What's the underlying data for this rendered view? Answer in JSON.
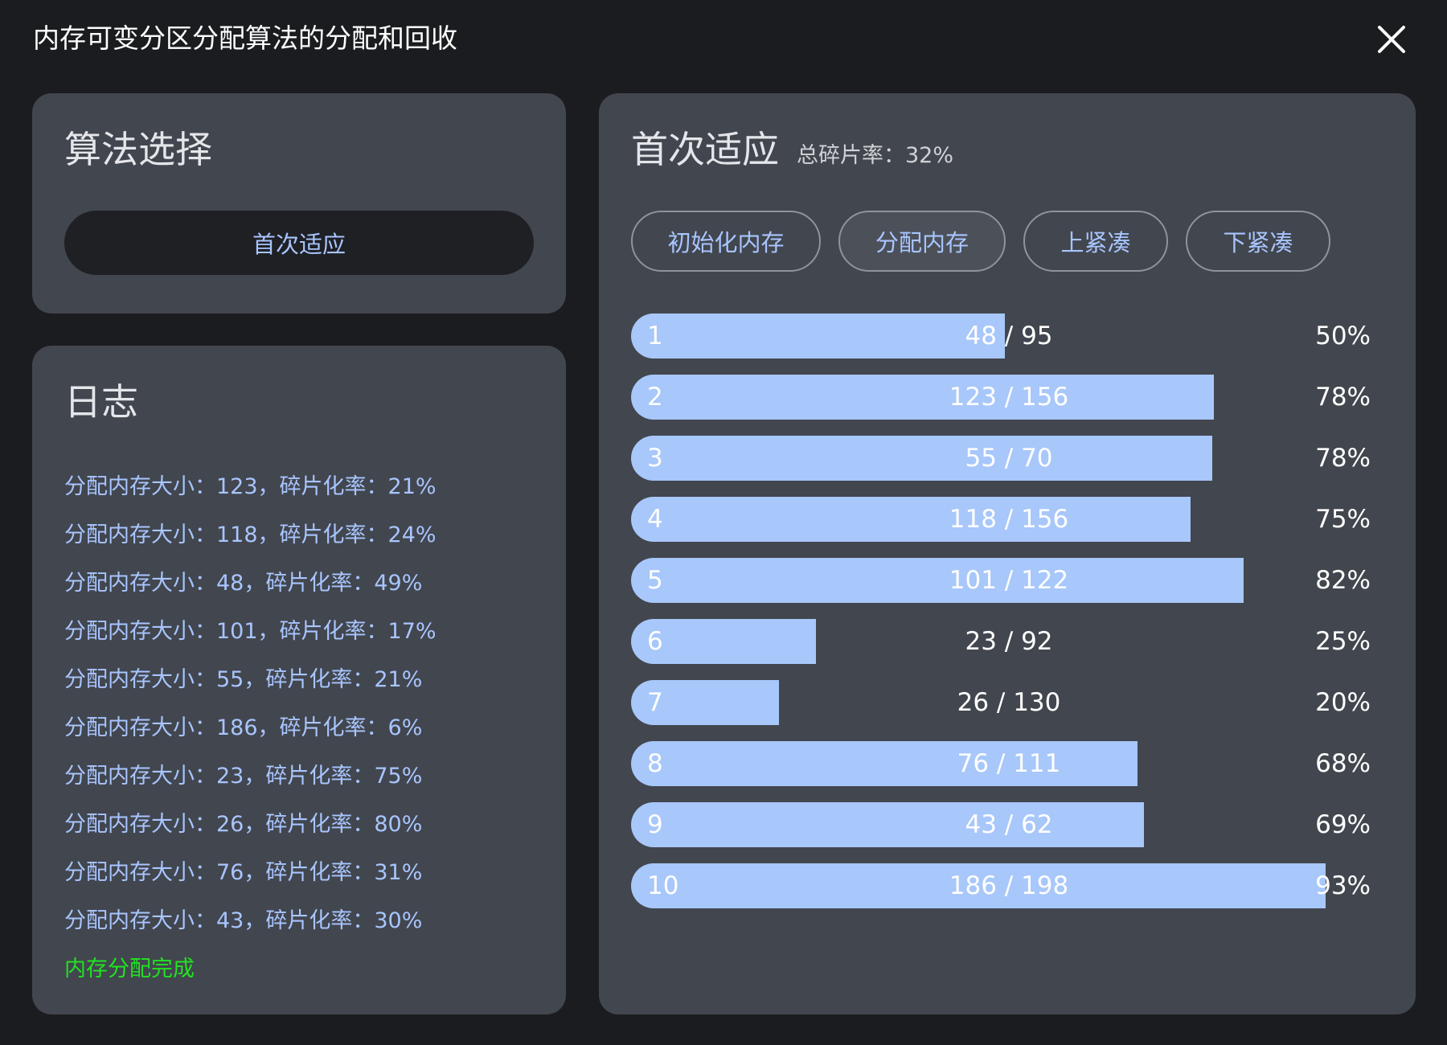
{
  "window": {
    "title": "内存可变分区分配算法的分配和回收"
  },
  "algorithm_panel": {
    "heading": "算法选择",
    "selected": "首次适应"
  },
  "log_panel": {
    "heading": "日志",
    "entries": [
      "分配内存大小：123，碎片化率：21%",
      "分配内存大小：118，碎片化率：24%",
      "分配内存大小：48，碎片化率：49%",
      "分配内存大小：101，碎片化率：17%",
      "分配内存大小：55，碎片化率：21%",
      "分配内存大小：186，碎片化率：6%",
      "分配内存大小：23，碎片化率：75%",
      "分配内存大小：26，碎片化率：80%",
      "分配内存大小：76，碎片化率：31%",
      "分配内存大小：43，碎片化率：30%"
    ],
    "done_message": "内存分配完成",
    "done_color": "#22e222"
  },
  "main_panel": {
    "title": "首次适应",
    "fragmentation": "总碎片率：32%",
    "buttons": [
      "初始化内存",
      "分配内存",
      "上紧凑",
      "下紧凑"
    ],
    "active_button_index": 1,
    "partitions": [
      {
        "id": "1",
        "used": 48,
        "total": 95,
        "usage": "48 / 95",
        "percent": "50%"
      },
      {
        "id": "2",
        "used": 123,
        "total": 156,
        "usage": "123 / 156",
        "percent": "78%"
      },
      {
        "id": "3",
        "used": 55,
        "total": 70,
        "usage": "55 / 70",
        "percent": "78%"
      },
      {
        "id": "4",
        "used": 118,
        "total": 156,
        "usage": "118 / 156",
        "percent": "75%"
      },
      {
        "id": "5",
        "used": 101,
        "total": 122,
        "usage": "101 / 122",
        "percent": "82%"
      },
      {
        "id": "6",
        "used": 23,
        "total": 92,
        "usage": "23 / 92",
        "percent": "25%"
      },
      {
        "id": "7",
        "used": 26,
        "total": 130,
        "usage": "26 / 130",
        "percent": "20%"
      },
      {
        "id": "8",
        "used": 76,
        "total": 111,
        "usage": "76 / 111",
        "percent": "68%"
      },
      {
        "id": "9",
        "used": 43,
        "total": 62,
        "usage": "43 / 62",
        "percent": "69%"
      },
      {
        "id": "10",
        "used": 186,
        "total": 198,
        "usage": "186 / 198",
        "percent": "93%"
      }
    ]
  },
  "colors": {
    "background": "#1b1c1f",
    "panel": "#42464e",
    "accent_text": "#a8c5ff",
    "bar_fill": "#a8c7fa"
  },
  "icons": {
    "close": "close-icon"
  }
}
